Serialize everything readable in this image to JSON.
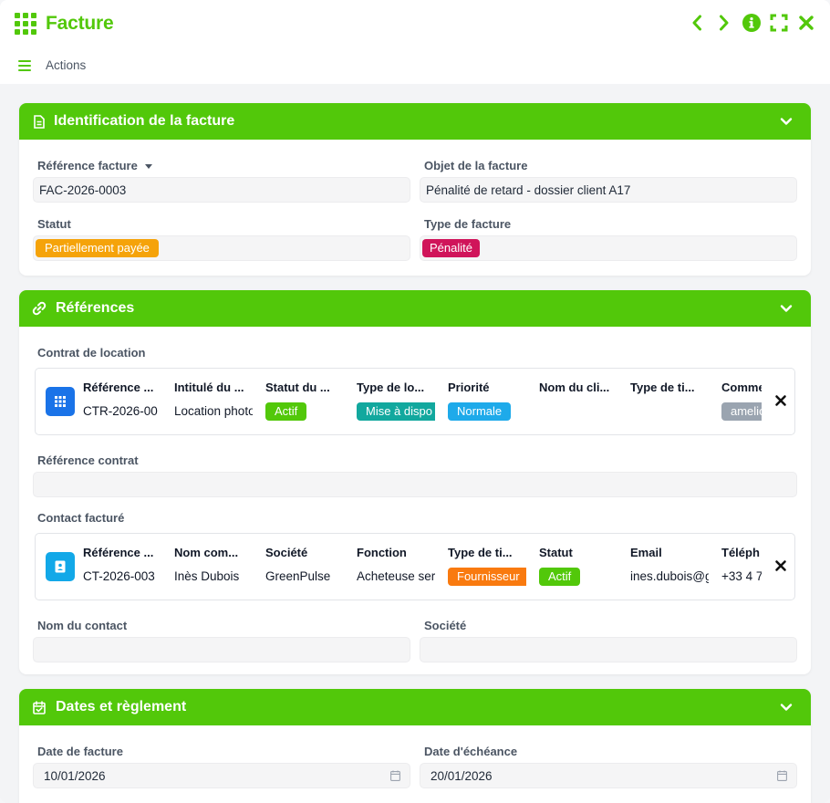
{
  "app": {
    "title": "Facture"
  },
  "toolbar": {
    "actions_label": "Actions"
  },
  "colors": {
    "brand": "#52c80a"
  },
  "sections": {
    "identification": {
      "title": "Identification de la facture",
      "ref_label": "Référence facture",
      "ref_value": "FAC-2026-0003",
      "object_label": "Objet de la facture",
      "object_value": "Pénalité de retard - dossier client A17",
      "status_label": "Statut",
      "status_value": "Partiellement payée",
      "status_color": "#f5a30a",
      "type_label": "Type de facture",
      "type_value": "Pénalité",
      "type_color": "#d0145a"
    },
    "references": {
      "title": "Références",
      "contract_label": "Contrat de location",
      "contract": {
        "headers": [
          "Référence ...",
          "Intitulé du ...",
          "Statut du ...",
          "Type de lo...",
          "Priorité",
          "Nom du cli...",
          "Type de ti...",
          "Comme"
        ],
        "ref": "CTR-2026-00",
        "title": "Location photo",
        "status": "Actif",
        "type": "Mise à dispo",
        "priority": "Normale",
        "comment": "amelio"
      },
      "contract_ref_label": "Référence contrat",
      "contact_label": "Contact facturé",
      "contact": {
        "headers": [
          "Référence ...",
          "Nom com...",
          "Société",
          "Fonction",
          "Type de ti...",
          "Statut",
          "Email",
          "Téléph"
        ],
        "ref": "CT-2026-003",
        "name": "Inès Dubois",
        "company": "GreenPulse",
        "function": "Acheteuse ser",
        "type": "Fournisseur",
        "status": "Actif",
        "email": "ines.dubois@g",
        "phone": "+33 4 7"
      },
      "contact_name_label": "Nom du contact",
      "company_label": "Société"
    },
    "dates": {
      "title": "Dates et règlement",
      "invoice_date_label": "Date de facture",
      "invoice_date_value": "10/01/2026",
      "due_date_label": "Date d'échéance",
      "due_date_value": "20/01/2026"
    }
  }
}
